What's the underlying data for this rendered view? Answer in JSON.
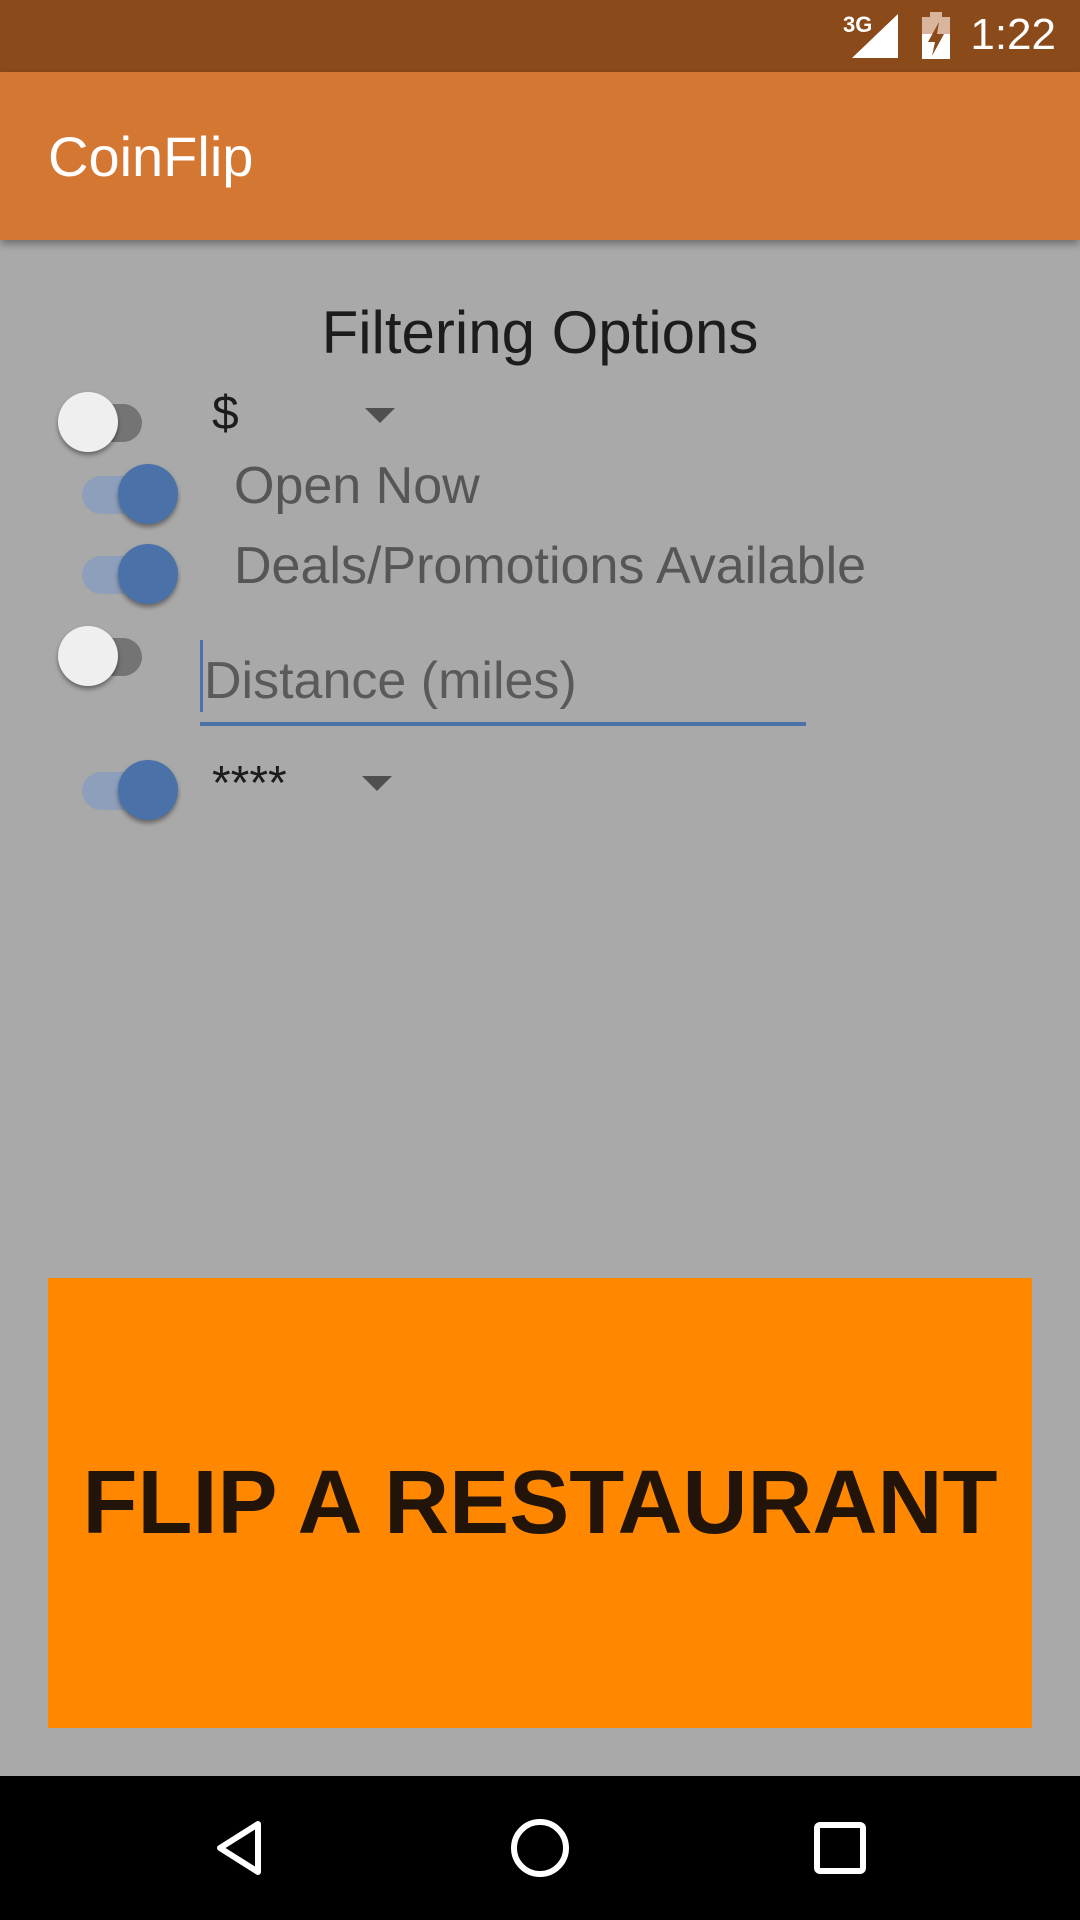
{
  "status_bar": {
    "network": "3G",
    "time": "1:22",
    "icons": [
      "signal-icon",
      "battery-charging-icon"
    ]
  },
  "app_bar": {
    "title": "CoinFlip"
  },
  "filters": {
    "title": "Filtering Options",
    "price": {
      "enabled": false,
      "selected": "$"
    },
    "open_now": {
      "enabled": true,
      "label": "Open Now"
    },
    "deals": {
      "enabled": true,
      "label": "Deals/Promotions Available"
    },
    "distance": {
      "enabled": false,
      "value": "",
      "placeholder": "Distance (miles)"
    },
    "rating": {
      "enabled": true,
      "selected": "****"
    }
  },
  "actions": {
    "flip_label": "FLIP A RESTAURANT"
  },
  "nav_bar": {
    "icons": [
      "back-icon",
      "home-icon",
      "recents-icon"
    ]
  },
  "colors": {
    "status_bar": "#8b4a19",
    "app_bar": "#d37733",
    "background": "#a9a9a9",
    "accent": "#4a72a8",
    "button": "#ff8800"
  }
}
